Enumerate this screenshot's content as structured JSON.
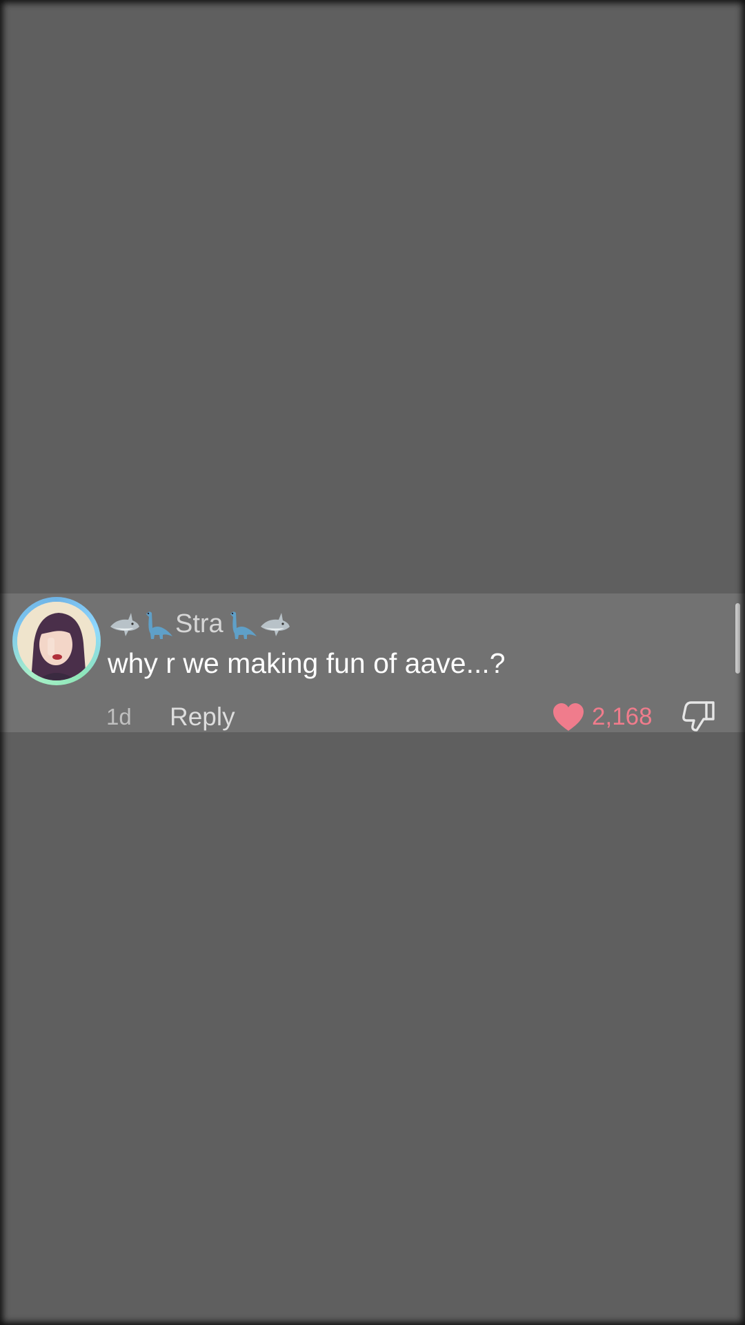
{
  "comment": {
    "username_text": "Stra",
    "username_emojis": [
      "shark-emoji",
      "dinosaur-emoji",
      "dinosaur-emoji",
      "shark-emoji"
    ],
    "text": "why r we making fun of aave...?",
    "time_ago": "1d",
    "reply_label": "Reply",
    "like_count": "2,168",
    "liked": true
  },
  "colors": {
    "background": "#5f5f5f",
    "card": "#727272",
    "like": "#f07c8c"
  }
}
